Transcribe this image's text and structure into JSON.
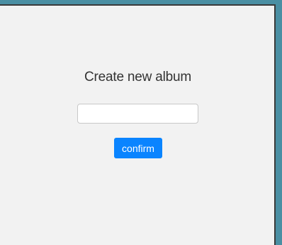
{
  "dialog": {
    "title": "Create new album",
    "album_name_value": "",
    "album_name_placeholder": "",
    "confirm_label": "confirm"
  },
  "colors": {
    "background": "#f2f2f2",
    "accent": "#0a84ff",
    "outer": "#4a8fa3"
  }
}
